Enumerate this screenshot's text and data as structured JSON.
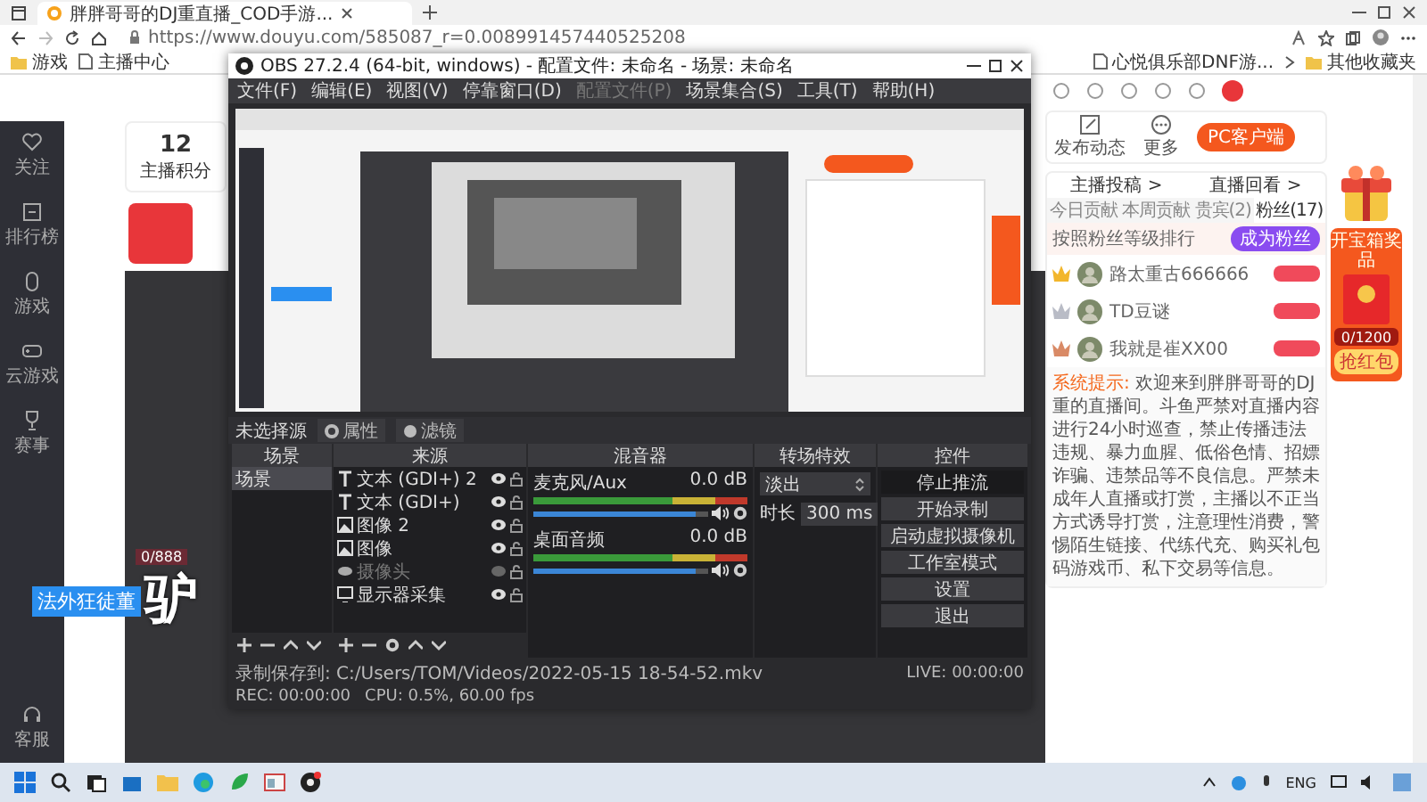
{
  "browser": {
    "tab_title": "胖胖哥哥的DJ重直播_COD手游...",
    "url": "https://www.douyu.com/585087_r=0.008991457440525208",
    "bookmarks": [
      {
        "label": "游戏",
        "kind": "folder"
      },
      {
        "label": "主播中心",
        "kind": "page"
      }
    ],
    "bookmarks_right": [
      {
        "label": "心悦俱乐部DNF游...",
        "kind": "page"
      },
      {
        "label": "其他收藏夹",
        "kind": "folder"
      }
    ]
  },
  "sidebar": {
    "items": [
      "关注",
      "排行榜",
      "游戏",
      "云游戏",
      "赛事"
    ],
    "footer": "客服"
  },
  "anchor_card": {
    "score": "12",
    "score_label": "主播积分"
  },
  "overlay": {
    "badge": "法外狂徒董",
    "big_text": "驴",
    "counter": "0/888"
  },
  "actions": {
    "items": [
      "发布动态",
      "更多"
    ],
    "pc_client": "PC客户端"
  },
  "rank_panel": {
    "links": [
      "主播投稿 >",
      "直播回看 >"
    ],
    "tabs": [
      {
        "label": "今日贡献",
        "selected": false
      },
      {
        "label": "本周贡献",
        "selected": false
      },
      {
        "label": "贵宾(2)",
        "selected": false
      },
      {
        "label": "粉丝(17)",
        "selected": true
      }
    ],
    "hint": "按照粉丝等级排行",
    "join": "成为粉丝",
    "rows": [
      {
        "name": "路太重古666666",
        "color": "#f2b62c"
      },
      {
        "name": "TD豆谜",
        "color": "#b9bcc6"
      },
      {
        "name": "我就是崔XX00",
        "color": "#d98a66"
      }
    ],
    "system_label": "系统提示:",
    "system_text": "欢迎来到胖胖哥哥的DJ重的直播间。斗鱼严禁对直播内容进行24小时巡查，禁止传播违法违规、暴力血腥、低俗色情、招嫖诈骗、违禁品等不良信息。严禁未成年人直播或打赏，主播以不正当方式诱导打赏，注意理性消费，警惕陌生链接、代练代充、购买礼包码游戏币、私下交易等信息。"
  },
  "red_packet": {
    "title": "开宝箱奖品",
    "progress": "0/1200",
    "level": 0,
    "button": "抢红包"
  },
  "obs": {
    "title": "OBS 27.2.4 (64-bit, windows) - 配置文件: 未命名 - 场景: 未命名",
    "menu": [
      {
        "label": "文件(F)",
        "disabled": false
      },
      {
        "label": "编辑(E)",
        "disabled": false
      },
      {
        "label": "视图(V)",
        "disabled": false
      },
      {
        "label": "停靠窗口(D)",
        "disabled": false
      },
      {
        "label": "配置文件(P)",
        "disabled": true
      },
      {
        "label": "场景集合(S)",
        "disabled": false
      },
      {
        "label": "工具(T)",
        "disabled": false
      },
      {
        "label": "帮助(H)",
        "disabled": false
      }
    ],
    "source_bar": {
      "label": "未选择源",
      "buttons": [
        "属性",
        "滤镜"
      ]
    },
    "scenes": {
      "title": "场景",
      "items": [
        {
          "name": "场景",
          "selected": true
        }
      ]
    },
    "sources": {
      "title": "来源",
      "items": [
        {
          "kind": "text",
          "name": "文本 (GDI+) 2",
          "visible": true
        },
        {
          "kind": "text",
          "name": "文本 (GDI+)",
          "visible": true
        },
        {
          "kind": "image",
          "name": "图像 2",
          "visible": true
        },
        {
          "kind": "image",
          "name": "图像",
          "visible": true
        },
        {
          "kind": "camera",
          "name": "摄像头",
          "visible": false
        },
        {
          "kind": "display",
          "name": "显示器采集",
          "visible": true
        }
      ]
    },
    "mixer": {
      "title": "混音器",
      "channels": [
        {
          "name": "麦克风/Aux",
          "reading": "0.0 dB",
          "level": 0.93
        },
        {
          "name": "桌面音频",
          "reading": "0.0 dB",
          "level": 0.93
        }
      ]
    },
    "transitions": {
      "title": "转场特效",
      "value": "淡出",
      "duration_label": "时长",
      "duration": "300 ms"
    },
    "controls": {
      "title": "控件",
      "buttons": [
        {
          "label": "停止推流",
          "active": true
        },
        {
          "label": "开始录制",
          "active": false
        },
        {
          "label": "启动虚拟摄像机",
          "active": false
        },
        {
          "label": "工作室模式",
          "active": false
        },
        {
          "label": "设置",
          "active": false
        },
        {
          "label": "退出",
          "active": false
        }
      ]
    },
    "status": {
      "path": "录制保存到: C:/Users/TOM/Videos/2022-05-15 18-54-52.mkv",
      "live": "LIVE: 00:00:00",
      "rec": "REC: 00:00:00",
      "cpu": "CPU: 0.5%, 60.00 fps"
    }
  },
  "taskbar": {
    "language": "ENG"
  }
}
